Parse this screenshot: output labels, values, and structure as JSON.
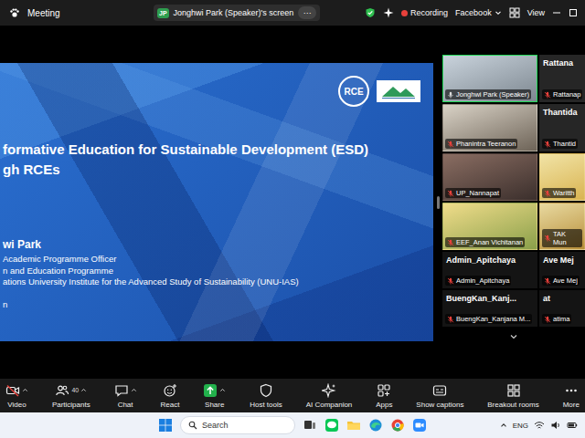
{
  "window": {
    "title": "Meeting"
  },
  "top_bar": {
    "share_badge": "JP",
    "share_label": "Jonghwi Park (Speaker)'s screen",
    "share_menu": "···",
    "recording": true,
    "recording_label": "Recording",
    "stream_label": "Facebook",
    "view_label": "View"
  },
  "slide": {
    "title_lines": [
      "formative Education for Sustainable Development (ESD)",
      "gh RCEs"
    ],
    "presenter": "wi Park",
    "details": [
      "Academic Programme Officer",
      "n and Education Programme",
      "ations University Institute for the Advanced Study of Sustainability (UNU-IAS)"
    ],
    "footer": "n",
    "logo": "RCE"
  },
  "gallery": {
    "tiles": [
      {
        "header": "",
        "name": "Jonghwi Park (Speaker)",
        "kind": "video",
        "muted": false,
        "speaking": true
      },
      {
        "header": "Rattana",
        "name": "Rattanap",
        "kind": "avatar",
        "muted": true,
        "speaking": false
      },
      {
        "header": "",
        "name": "Phanintra Teeranon",
        "kind": "video",
        "muted": true,
        "speaking": false
      },
      {
        "header": "Thantida",
        "name": "Thantid",
        "kind": "avatar",
        "muted": true,
        "speaking": false
      },
      {
        "header": "",
        "name": "UP_Nannapat",
        "kind": "video",
        "muted": true,
        "speaking": false
      },
      {
        "header": "",
        "name": "Waritth",
        "kind": "video",
        "muted": true,
        "speaking": false
      },
      {
        "header": "",
        "name": "EEF_Anan Vichitanan",
        "kind": "video",
        "muted": true,
        "speaking": false
      },
      {
        "header": "",
        "name": "TAK Mun",
        "kind": "video",
        "muted": true,
        "speaking": false
      },
      {
        "header": "Admin_Apitchaya",
        "name": "Admin_Apitchaya",
        "kind": "avatar",
        "muted": true,
        "speaking": false
      },
      {
        "header": "Ave Mej",
        "name": "Ave Mej",
        "kind": "avatar",
        "muted": true,
        "speaking": false
      },
      {
        "header": "BuengKan_Kanj...",
        "name": "BuengKan_Kanjana M...",
        "kind": "avatar",
        "muted": true,
        "speaking": false
      },
      {
        "header": "at",
        "name": "atima",
        "kind": "avatar",
        "muted": true,
        "speaking": false
      }
    ]
  },
  "toolbar": {
    "items": [
      {
        "label": "Video",
        "menu": true,
        "off": true,
        "highlighted": false
      },
      {
        "label": "Participants",
        "count": "40",
        "menu": true,
        "off": false,
        "highlighted": false
      },
      {
        "label": "Chat",
        "menu": true,
        "off": false,
        "highlighted": false
      },
      {
        "label": "React",
        "menu": false,
        "off": false,
        "highlighted": false
      },
      {
        "label": "Share",
        "menu": true,
        "off": false,
        "highlighted": true
      },
      {
        "label": "Host tools",
        "menu": false,
        "off": false,
        "highlighted": false
      },
      {
        "label": "AI Companion",
        "menu": false,
        "off": false,
        "highlighted": false
      },
      {
        "label": "Apps",
        "menu": false,
        "off": false,
        "highlighted": false
      },
      {
        "label": "Show captions",
        "menu": false,
        "off": false,
        "highlighted": false
      },
      {
        "label": "Breakout rooms",
        "menu": false,
        "off": false,
        "highlighted": false
      },
      {
        "label": "More",
        "menu": false,
        "off": false,
        "highlighted": false
      }
    ]
  },
  "taskbar": {
    "search_placeholder": "Search",
    "language": "ENG"
  }
}
